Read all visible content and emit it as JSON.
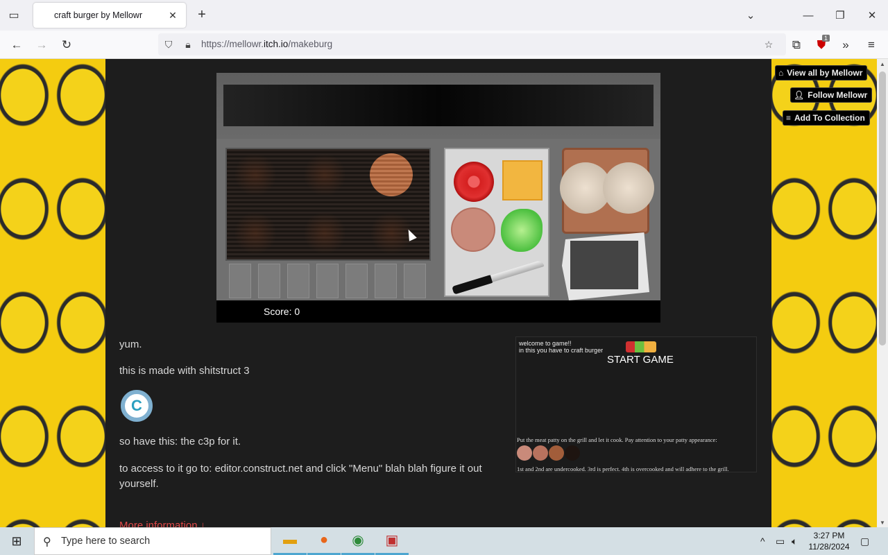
{
  "browser": {
    "tab_title": "craft burger by Mellowr",
    "url_prefix": "https://mellowr.",
    "url_host": "itch.io",
    "url_path": "/makeburg",
    "extension_badge": "1"
  },
  "game": {
    "score_text": "Score: 0"
  },
  "side_buttons": {
    "view_all": "View all by Mellowr",
    "follow": "Follow Mellowr",
    "add_collection": "Add To Collection"
  },
  "description": {
    "line1": "yum.",
    "line2": "this is made with shitstruct 3",
    "logo_text": "C",
    "line3": "so have this: the c3p for it.",
    "line4": "to access to it go to: editor.construct.net and click \"Menu\" blah blah figure it out yourself.",
    "more_info": "More information ↓"
  },
  "screenshot": {
    "welcome": "welcome to game!!",
    "subtitle": "in this you have to craft burger",
    "start": "START GAME",
    "caption1": "Put the meat patty on the grill and let it cook. Pay attention to your patty appearance:",
    "caption2": "1st and 2nd are undercooked. 3rd is perfect. 4th is overcooked and will adhere to the grill.",
    "swatch_colors": [
      "#c98a7a",
      "#b8725e",
      "#a25d3a",
      "#1e1410"
    ]
  },
  "taskbar": {
    "search_placeholder": "Type here to search",
    "time": "3:27 PM",
    "date": "11/28/2024"
  }
}
